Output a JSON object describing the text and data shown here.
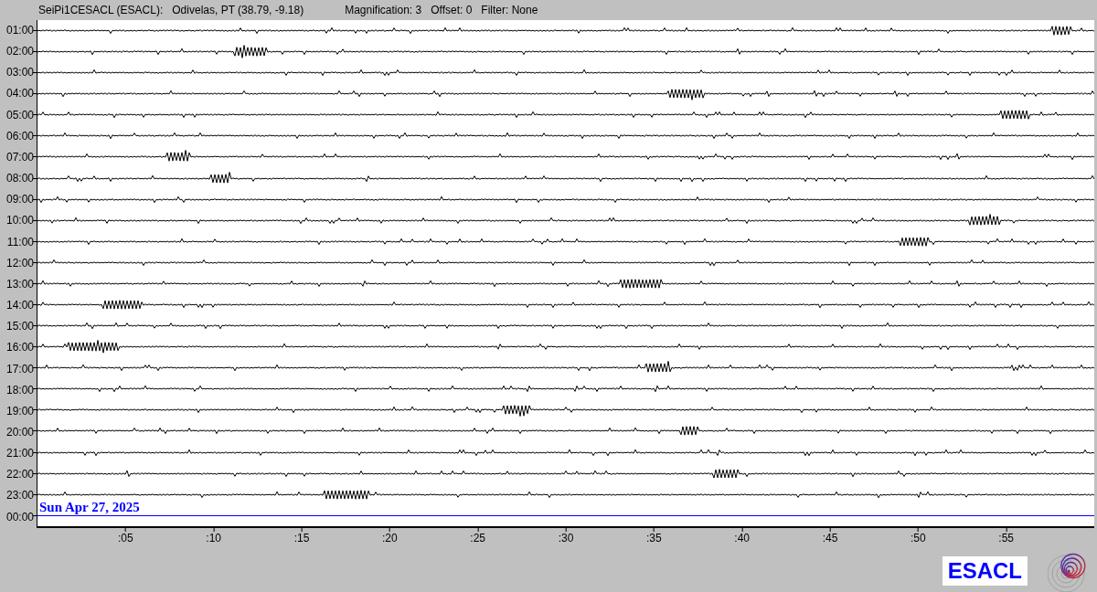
{
  "header": {
    "station": "SeiPi1CESACL (ESACL):",
    "location": "Odivelas, PT (38.79, -9.18)",
    "magnification": "Magnification: 3",
    "offset": "Offset: 0",
    "filter": "Filter: None"
  },
  "rows": [
    {
      "label": "01:00",
      "kind": "trace"
    },
    {
      "label": "02:00",
      "kind": "trace"
    },
    {
      "label": "03:00",
      "kind": "trace"
    },
    {
      "label": "04:00",
      "kind": "trace"
    },
    {
      "label": "05:00",
      "kind": "trace"
    },
    {
      "label": "06:00",
      "kind": "trace"
    },
    {
      "label": "07:00",
      "kind": "trace"
    },
    {
      "label": "08:00",
      "kind": "trace"
    },
    {
      "label": "09:00",
      "kind": "trace"
    },
    {
      "label": "10:00",
      "kind": "trace"
    },
    {
      "label": "11:00",
      "kind": "trace"
    },
    {
      "label": "12:00",
      "kind": "trace"
    },
    {
      "label": "13:00",
      "kind": "trace"
    },
    {
      "label": "14:00",
      "kind": "trace"
    },
    {
      "label": "15:00",
      "kind": "trace"
    },
    {
      "label": "16:00",
      "kind": "trace"
    },
    {
      "label": "17:00",
      "kind": "trace"
    },
    {
      "label": "18:00",
      "kind": "trace"
    },
    {
      "label": "19:00",
      "kind": "trace"
    },
    {
      "label": "20:00",
      "kind": "trace"
    },
    {
      "label": "21:00",
      "kind": "trace"
    },
    {
      "label": "22:00",
      "kind": "trace"
    },
    {
      "label": "23:00",
      "kind": "trace"
    },
    {
      "label": "00:00",
      "kind": "current"
    }
  ],
  "date": "Sun Apr 27, 2025",
  "xticks": [
    ":05",
    ":10",
    ":15",
    ":20",
    ":25",
    ":30",
    ":35",
    ":40",
    ":45",
    ":50",
    ":55"
  ],
  "logo": "ESACL"
}
